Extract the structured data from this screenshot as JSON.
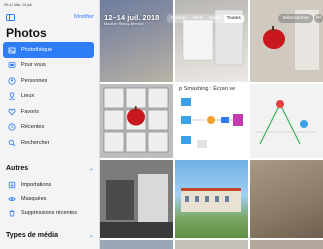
{
  "status_bar": {
    "text": "09:41  Mar. 14 juil."
  },
  "sidebar": {
    "modify_label": "Modifier",
    "title": "Photos",
    "items": [
      {
        "label": "Photothèque",
        "icon": "photo-library-icon",
        "active": true
      },
      {
        "label": "Pour vous",
        "icon": "for-you-icon",
        "active": false
      },
      {
        "label": "Personnes",
        "icon": "people-icon",
        "active": false
      },
      {
        "label": "Lieux",
        "icon": "map-pin-icon",
        "active": false
      },
      {
        "label": "Favoris",
        "icon": "heart-icon",
        "active": false
      },
      {
        "label": "Récentes",
        "icon": "clock-icon",
        "active": false
      },
      {
        "label": "Rechercher",
        "icon": "search-icon",
        "active": false
      }
    ],
    "section_autres": "Autres",
    "autres_items": [
      {
        "label": "Importations",
        "icon": "import-icon"
      },
      {
        "label": "Masquées",
        "icon": "eye-hidden-icon"
      },
      {
        "label": "Suppressions récentes",
        "icon": "trash-icon"
      }
    ],
    "section_media": "Types de média"
  },
  "main": {
    "date_title": "12–14 juil. 2018",
    "date_subtitle": "Moulton Riding-Brentch",
    "segments": [
      "Années",
      "Mois",
      "Jours",
      "Toutes"
    ],
    "selected_segment": "Toutes",
    "select_label": "Sélectionner",
    "more_label": "•••",
    "smash_caption": "p Smashing : Écran ve"
  },
  "colors": {
    "accent": "#2f7df6",
    "sidebar_bg": "#f4f4f7"
  }
}
